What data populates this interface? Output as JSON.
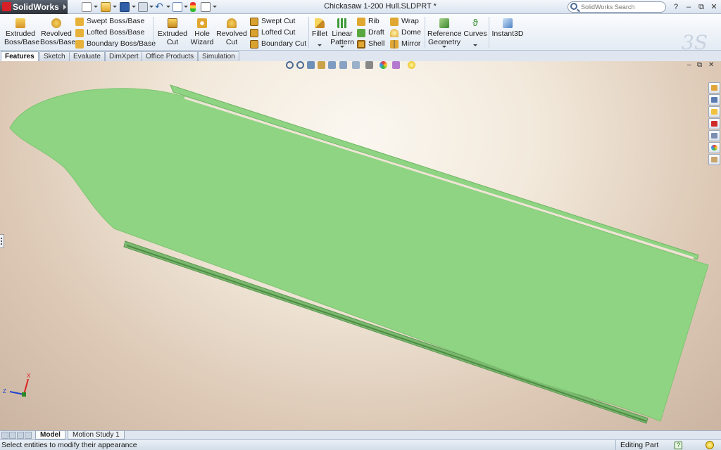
{
  "app": {
    "name": "SolidWorks",
    "document_title": "Chickasaw 1-200 Hull.SLDPRT *"
  },
  "search": {
    "placeholder": "SolidWorks Search"
  },
  "window_controls": {
    "help": "?",
    "minimize": "–",
    "restore": "⧉",
    "close": "✕"
  },
  "ribbon": {
    "extruded_boss": [
      "Extruded",
      "Boss/Base"
    ],
    "revolved_boss": [
      "Revolved",
      "Boss/Base"
    ],
    "swept_boss": "Swept Boss/Base",
    "lofted_boss": "Lofted Boss/Base",
    "boundary_boss": "Boundary Boss/Base",
    "extruded_cut": [
      "Extruded",
      "Cut"
    ],
    "hole_wizard": [
      "Hole",
      "Wizard"
    ],
    "revolved_cut": [
      "Revolved",
      "Cut"
    ],
    "swept_cut": "Swept Cut",
    "lofted_cut": "Lofted Cut",
    "boundary_cut": "Boundary Cut",
    "fillet": "Fillet",
    "linear_pattern": [
      "Linear",
      "Pattern"
    ],
    "rib": "Rib",
    "draft": "Draft",
    "shell": "Shell",
    "wrap": "Wrap",
    "dome": "Dome",
    "mirror": "Mirror",
    "reference_geometry": [
      "Reference",
      "Geometry"
    ],
    "curves": "Curves",
    "instant3d": "Instant3D"
  },
  "tabs": [
    "Features",
    "Sketch",
    "Evaluate",
    "DimXpert",
    "Office Products",
    "Simulation"
  ],
  "active_tab": "Features",
  "triad": {
    "x": "X",
    "z": "Z"
  },
  "bottom_tabs": [
    "Model",
    "Motion Study 1"
  ],
  "status": {
    "message": "Select entities to modify their appearance",
    "mode": "Editing Part",
    "help": "?"
  },
  "colors": {
    "model_green": "#8fd482",
    "model_edge": "#5ea653",
    "accent_red": "#d61f26"
  }
}
